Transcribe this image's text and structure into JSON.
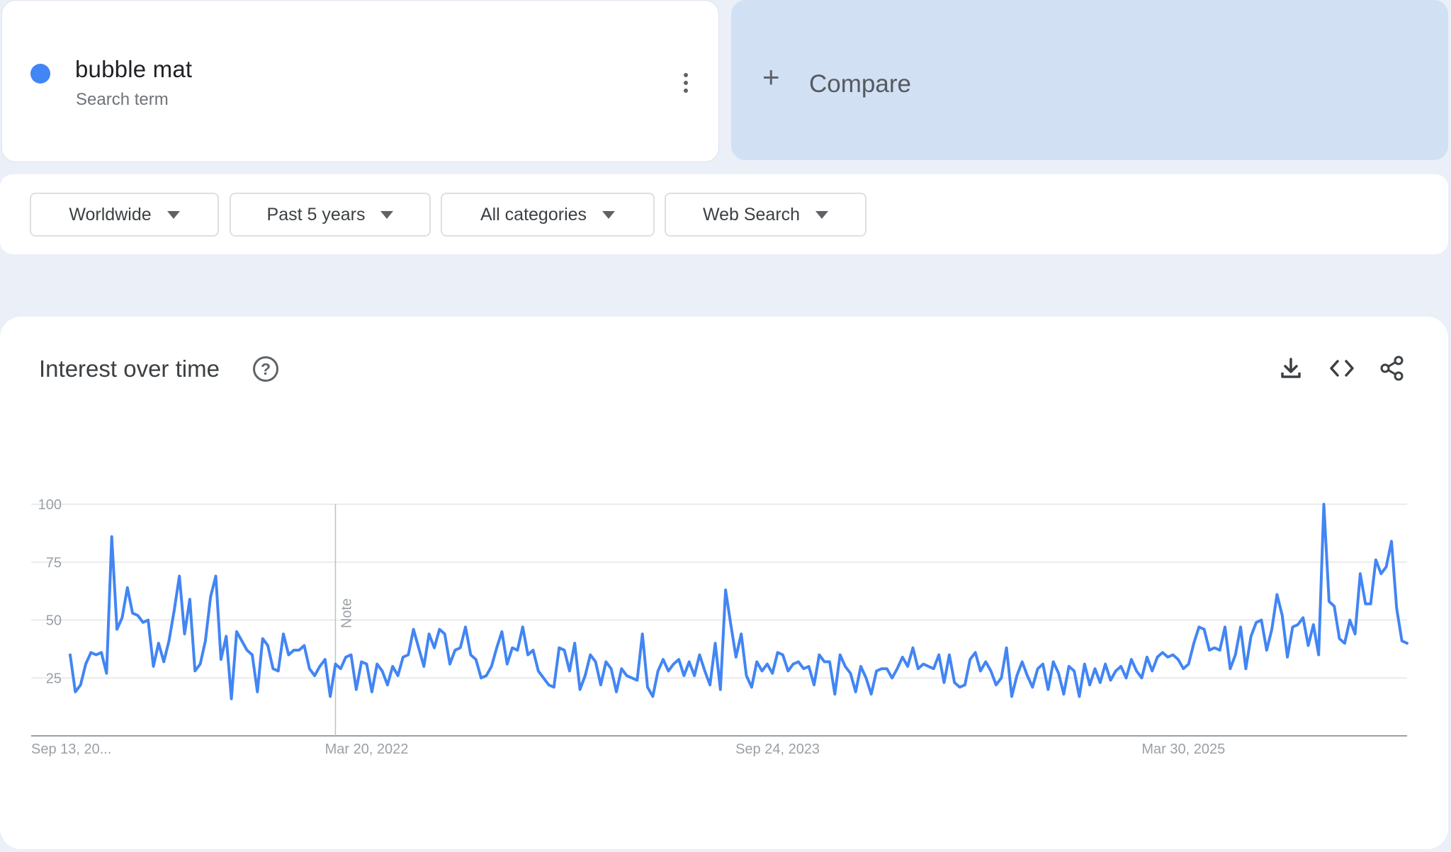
{
  "term": {
    "name": "bubble mat",
    "subtitle": "Search term",
    "color": "#4285f4"
  },
  "compare": {
    "icon": "plus-icon",
    "label": "Compare"
  },
  "filters": {
    "region": "Worldwide",
    "time": "Past 5 years",
    "category": "All categories",
    "property": "Web Search"
  },
  "panel": {
    "title": "Interest over time",
    "help_icon": "?",
    "tools": [
      "download-icon",
      "embed-code-icon",
      "share-icon"
    ]
  },
  "chart_data": {
    "type": "line",
    "title": "",
    "xlabel": "",
    "ylabel": "",
    "ylim": [
      0,
      100
    ],
    "yticks": [
      "25",
      "50",
      "75",
      "100"
    ],
    "x_tick_labels": [
      "Sep 13, 20...",
      "Mar 20, 2022",
      "Sep 24, 2023",
      "Mar 30, 2025"
    ],
    "annotation": {
      "label": "Note",
      "at_week": 51
    },
    "grid": true,
    "legend": "none",
    "series": [
      {
        "color": "#4285f4",
        "values": [
          35,
          19,
          22,
          31,
          36,
          35,
          36,
          27,
          86,
          46,
          51,
          64,
          53,
          52,
          49,
          50,
          30,
          40,
          32,
          41,
          54,
          69,
          44,
          59,
          28,
          31,
          41,
          60,
          69,
          33,
          43,
          16,
          45,
          41,
          37,
          35,
          19,
          42,
          39,
          29,
          28,
          44,
          35,
          37,
          37,
          39,
          29,
          26,
          30,
          33,
          17,
          31,
          29,
          34,
          35,
          20,
          32,
          31,
          19,
          31,
          28,
          22,
          30,
          26,
          34,
          35,
          46,
          38,
          30,
          44,
          38,
          46,
          44,
          31,
          37,
          38,
          47,
          35,
          33,
          25,
          26,
          30,
          38,
          45,
          31,
          38,
          37,
          47,
          35,
          37,
          28,
          25,
          22,
          21,
          38,
          37,
          28,
          40,
          20,
          26,
          35,
          32,
          22,
          32,
          29,
          19,
          29,
          26,
          25,
          24,
          44,
          21,
          17,
          28,
          33,
          28,
          31,
          33,
          26,
          32,
          26,
          35,
          28,
          22,
          40,
          20,
          63,
          48,
          34,
          44,
          26,
          21,
          32,
          28,
          31,
          27,
          36,
          35,
          28,
          31,
          32,
          29,
          30,
          22,
          35,
          32,
          32,
          18,
          35,
          30,
          27,
          19,
          30,
          25,
          18,
          28,
          29,
          29,
          25,
          29,
          34,
          30,
          38,
          29,
          31,
          30,
          29,
          35,
          23,
          35,
          23,
          21,
          22,
          33,
          36,
          28,
          32,
          28,
          22,
          25,
          38,
          17,
          26,
          32,
          26,
          21,
          29,
          31,
          20,
          32,
          27,
          18,
          30,
          28,
          17,
          31,
          22,
          29,
          23,
          31,
          24,
          28,
          30,
          25,
          33,
          28,
          25,
          34,
          28,
          34,
          36,
          34,
          35,
          33,
          29,
          31,
          40,
          47,
          46,
          37,
          38,
          37,
          47,
          29,
          35,
          47,
          29,
          43,
          49,
          50,
          37,
          46,
          61,
          52,
          34,
          47,
          48,
          51,
          39,
          48,
          35,
          100,
          58,
          56,
          42,
          40,
          50,
          44,
          70,
          57,
          57,
          76,
          70,
          73,
          84,
          55,
          41,
          40
        ]
      }
    ]
  }
}
